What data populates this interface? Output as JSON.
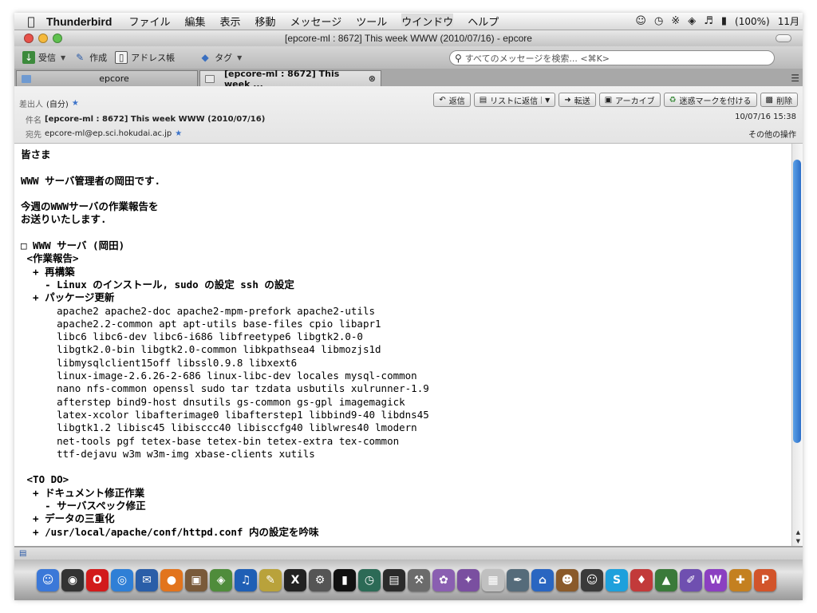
{
  "menubar": {
    "app_name": "Thunderbird",
    "items": [
      "ファイル",
      "編集",
      "表示",
      "移動",
      "メッセージ",
      "ツール",
      "ウインドウ",
      "ヘルプ"
    ],
    "battery": "(100%)",
    "clock": "11月"
  },
  "window": {
    "title": "[epcore-ml : 8672] This week WWW (2010/07/16) - epcore"
  },
  "toolbar": {
    "get_mail": "受信",
    "compose": "作成",
    "address_book": "アドレス帳",
    "tag": "タグ",
    "search_placeholder": "すべてのメッセージを検索... <⌘K>"
  },
  "tabs": [
    {
      "label": "epcore"
    },
    {
      "label": "[epcore-ml : 8672] This week ..."
    }
  ],
  "header": {
    "from_label": "差出人",
    "from_value": "(自分)",
    "subject_label": "件名",
    "subject_value": "[epcore-ml : 8672] This week WWW (2010/07/16)",
    "to_label": "宛先",
    "to_value": "epcore-ml@ep.sci.hokudai.ac.jp",
    "date": "10/07/16 15:38",
    "other_actions": "その他の操作",
    "actions": {
      "reply": "返信",
      "reply_list": "リストに返信",
      "forward": "転送",
      "archive": "アーカイブ",
      "junk": "迷惑マークを付ける",
      "delete": "削除"
    }
  },
  "message": {
    "lines": [
      "皆さま",
      "",
      "WWW サーバ管理者の岡田です.",
      "",
      "今週のWWWサーバの作業報告を",
      "お送りいたします.",
      "",
      "□ WWW サーバ (岡田)",
      " <作業報告>",
      "  + 再構築",
      "    - Linux のインストール, sudo の設定 ssh の設定",
      "  + パッケージ更新",
      "      apache2 apache2-doc apache2-mpm-prefork apache2-utils",
      "      apache2.2-common apt apt-utils base-files cpio libapr1",
      "      libc6 libc6-dev libc6-i686 libfreetype6 libgtk2.0-0",
      "      libgtk2.0-bin libgtk2.0-common libkpathsea4 libmozjs1d",
      "      libmysqlclient15off libssl0.9.8 libxext6",
      "      linux-image-2.6.26-2-686 linux-libc-dev locales mysql-common",
      "      nano nfs-common openssl sudo tar tzdata usbutils xulrunner-1.9",
      "      afterstep bind9-host dnsutils gs-common gs-gpl imagemagick",
      "      latex-xcolor libafterimage0 libafterstep1 libbind9-40 libdns45",
      "      libgtk1.2 libisc45 libisccc40 libisccfg40 liblwres40 lmodern",
      "      net-tools pgf tetex-base tetex-bin tetex-extra tex-common",
      "      ttf-dejavu w3m w3m-img xbase-clients xutils",
      "",
      " <TO DO>",
      "  + ドキュメント修正作業",
      "    - サーバスペック修正",
      "  + データの三重化",
      "  + /usr/local/apache/conf/httpd.conf 内の設定を吟味"
    ]
  },
  "dock": {
    "icons": [
      {
        "name": "finder-icon",
        "glyph": "☺",
        "color": "#3b78d8"
      },
      {
        "name": "dashboard-icon",
        "glyph": "◉",
        "color": "#333333"
      },
      {
        "name": "opera-icon",
        "glyph": "O",
        "color": "#d21b1b"
      },
      {
        "name": "safari-icon",
        "glyph": "◎",
        "color": "#2f7fd6"
      },
      {
        "name": "thunderbird-icon",
        "glyph": "✉",
        "color": "#2a5ea8"
      },
      {
        "name": "firefox-icon",
        "glyph": "●",
        "color": "#e2741d"
      },
      {
        "name": "photo-icon",
        "glyph": "▣",
        "color": "#7a5a3a"
      },
      {
        "name": "preview-icon",
        "glyph": "◈",
        "color": "#4f8c3b"
      },
      {
        "name": "itunes-icon",
        "glyph": "♫",
        "color": "#1f5fb5"
      },
      {
        "name": "editor-icon",
        "glyph": "✎",
        "color": "#b9a23b"
      },
      {
        "name": "x11-icon",
        "glyph": "X",
        "color": "#222222"
      },
      {
        "name": "system-icon",
        "glyph": "⚙",
        "color": "#555555"
      },
      {
        "name": "terminal-icon",
        "glyph": "▮",
        "color": "#111111"
      },
      {
        "name": "timemachine-icon",
        "glyph": "◷",
        "color": "#2c6a56"
      },
      {
        "name": "monitor-icon",
        "glyph": "▤",
        "color": "#2b2b2b"
      },
      {
        "name": "utility-icon",
        "glyph": "⚒",
        "color": "#6b6b6b"
      },
      {
        "name": "paint-icon",
        "glyph": "✿",
        "color": "#8a5fb1"
      },
      {
        "name": "gimp-icon",
        "glyph": "✦",
        "color": "#7a4fa0"
      },
      {
        "name": "calendar-icon",
        "glyph": "▦",
        "color": "#c0c0c0"
      },
      {
        "name": "ink-icon",
        "glyph": "✒",
        "color": "#556b7a"
      },
      {
        "name": "home-icon",
        "glyph": "⌂",
        "color": "#2a66c1"
      },
      {
        "name": "owl-icon",
        "glyph": "☻",
        "color": "#8a5a2a"
      },
      {
        "name": "smiley-icon",
        "glyph": "☺",
        "color": "#3a3a3a"
      },
      {
        "name": "skype-icon",
        "glyph": "S",
        "color": "#1ea0dc"
      },
      {
        "name": "pin-icon",
        "glyph": "♦",
        "color": "#c23a3a"
      },
      {
        "name": "graph-icon",
        "glyph": "▲",
        "color": "#3a7a3a"
      },
      {
        "name": "pen-icon",
        "glyph": "✐",
        "color": "#6f4fb0"
      },
      {
        "name": "word-icon",
        "glyph": "W",
        "color": "#8b3fc1"
      },
      {
        "name": "tool-icon",
        "glyph": "✚",
        "color": "#c48020"
      },
      {
        "name": "powerpoint-icon",
        "glyph": "P",
        "color": "#d2542a"
      }
    ]
  }
}
